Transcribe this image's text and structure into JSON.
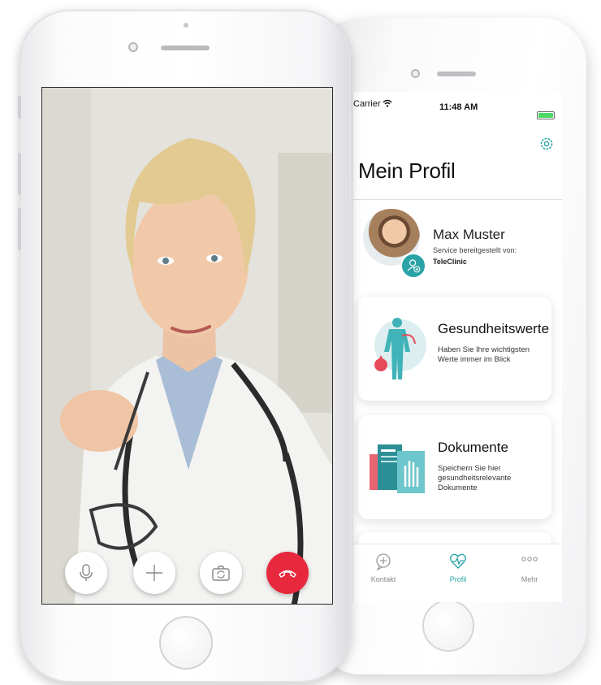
{
  "profile_app": {
    "status_bar": {
      "carrier": "Carrier",
      "time": "11:48 AM"
    },
    "title": "Mein Profil",
    "user": {
      "name": "Max Muster",
      "service_label": "Service bereitgestellt von:",
      "provider": "TeleClinic"
    },
    "cards": [
      {
        "title": "Gesundheitswerte",
        "description": "Haben Sie Ihre wichtigsten Werte immer im Blick",
        "icon": "health-body-illustration"
      },
      {
        "title": "Dokumente",
        "description": "Speichern Sie hier gesundheitsrelevante Dokumente",
        "icon": "documents-illustration"
      }
    ],
    "tab_bar": [
      {
        "label": "Kontakt",
        "icon": "chat-plus-icon",
        "active": false
      },
      {
        "label": "Profil",
        "icon": "heart-pulse-icon",
        "active": true
      },
      {
        "label": "Mehr",
        "icon": "more-dots-icon",
        "active": false
      }
    ],
    "accent_color": "#2aa3a6"
  },
  "video_call": {
    "controls": [
      {
        "name": "microphone",
        "icon": "microphone-icon"
      },
      {
        "name": "add",
        "icon": "plus-icon"
      },
      {
        "name": "switch-camera",
        "icon": "camera-switch-icon"
      },
      {
        "name": "end-call",
        "icon": "hang-up-icon",
        "color": "#e8283d"
      }
    ]
  }
}
